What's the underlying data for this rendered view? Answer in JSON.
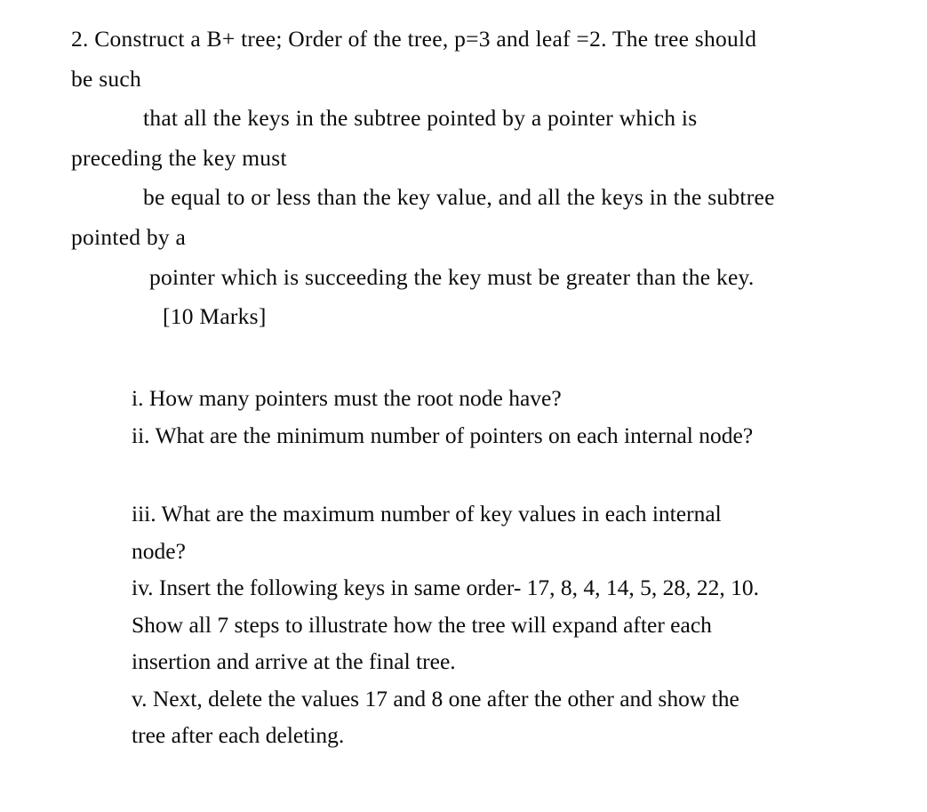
{
  "document": {
    "type": "exam-question",
    "question_number": "2.",
    "marks": "[10 Marks]",
    "stem": {
      "line1": "2. Construct a B+ tree; Order of the tree, p=3 and leaf =2. The tree should",
      "line2": "be such",
      "line3": "that all the keys in the subtree pointed by a pointer which is",
      "line4": "preceding the key must",
      "line5": "be equal to or less than the key value, and all the keys in the subtree",
      "line6": "pointed by a",
      "line7": "pointer which is succeeding the key must be greater than the key.",
      "line8": "[10 Marks]"
    },
    "sub_questions": [
      {
        "label": "i.",
        "lines": [
          "i. How many pointers must the root node have?"
        ]
      },
      {
        "label": "ii.",
        "lines": [
          "ii. What are the minimum number of pointers on each internal node?"
        ]
      },
      {
        "label": "iii.",
        "lines": [
          "iii. What are the maximum number of key values in each internal",
          "node?"
        ]
      },
      {
        "label": "iv.",
        "lines": [
          "iv. Insert the following keys in same order- 17, 8, 4, 14, 5, 28, 22, 10.",
          "Show all 7 steps to illustrate how the tree will expand after each",
          "insertion and arrive at the final tree."
        ]
      },
      {
        "label": "v.",
        "lines": [
          "v. Next, delete the values 17 and 8 one after the other and show the",
          "tree after each deleting."
        ]
      }
    ],
    "keys_to_insert": [
      17,
      8,
      4,
      14,
      5,
      28,
      22,
      10
    ],
    "keys_to_delete": [
      17,
      8
    ],
    "steps_count": "7",
    "tree_order_p": "3",
    "tree_leaf": "2",
    "colors": {
      "background": "#ffffff",
      "text": "#0c0c0c"
    }
  }
}
